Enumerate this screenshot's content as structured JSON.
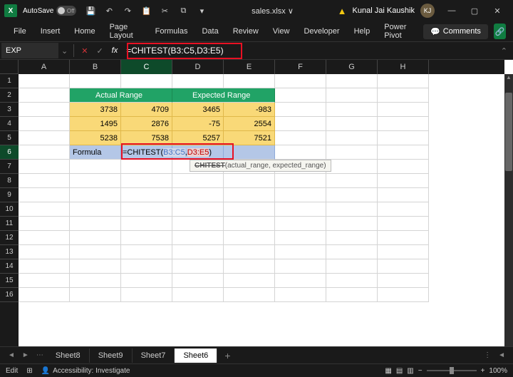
{
  "titlebar": {
    "autosave_label": "AutoSave",
    "autosave_state": "Off",
    "filename": "sales.xlsx  ∨",
    "user_name": "Kunal Jai Kaushik",
    "user_initials": "KJ"
  },
  "menu": {
    "items": [
      "File",
      "Insert",
      "Home",
      "Page Layout",
      "Formulas",
      "Data",
      "Review",
      "View",
      "Developer",
      "Help",
      "Power Pivot"
    ],
    "comments": "Comments"
  },
  "formula_bar": {
    "name_box": "EXP",
    "formula": "=CHITEST(B3:C5,D3:E5)"
  },
  "columns": [
    "A",
    "B",
    "C",
    "D",
    "E",
    "F",
    "G",
    "H"
  ],
  "rows": [
    "1",
    "2",
    "3",
    "4",
    "5",
    "6",
    "7",
    "8",
    "9",
    "10",
    "11",
    "12",
    "13",
    "14",
    "15",
    "16"
  ],
  "sheet": {
    "header_actual": "Actual Range",
    "header_expected": "Expected Range",
    "row3": {
      "b": "3738",
      "c": "4709",
      "d": "3465",
      "e": "-983"
    },
    "row4": {
      "b": "1495",
      "c": "2876",
      "d": "-75",
      "e": "2554"
    },
    "row5": {
      "b": "5238",
      "c": "7538",
      "d": "5257",
      "e": "7521"
    },
    "row6_label": "Formula",
    "row6_formula_prefix": "=CHITEST(",
    "row6_rng1": "B3:C5",
    "row6_comma": ",",
    "row6_rng2": "D3:E5",
    "row6_suffix": ")",
    "tooltip_fn": "CHITEST",
    "tooltip_args": "(actual_range, expected_range)"
  },
  "tabs": [
    "Sheet8",
    "Sheet9",
    "Sheet7",
    "Sheet6"
  ],
  "active_tab": "Sheet6",
  "status": {
    "mode": "Edit",
    "accessibility": "Accessibility: Investigate",
    "zoom": "100%"
  }
}
